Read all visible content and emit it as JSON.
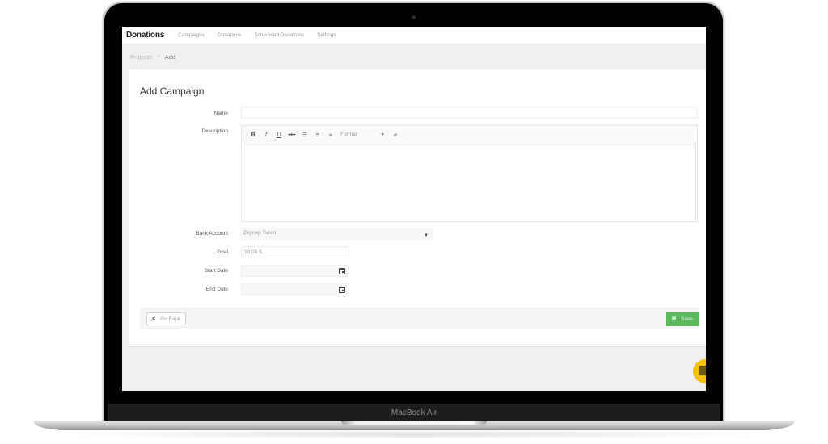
{
  "device": {
    "label": "MacBook Air"
  },
  "app": {
    "brand": "Donations",
    "nav": [
      {
        "label": "Campaigns"
      },
      {
        "label": "Donations"
      },
      {
        "label": "Scheduled Donations"
      },
      {
        "label": "Settings"
      }
    ]
  },
  "breadcrumb": {
    "parent": "Projects",
    "separator": ">",
    "current": "Add"
  },
  "form": {
    "title": "Add Campaign",
    "name": {
      "label": "Name",
      "value": ""
    },
    "description": {
      "label": "Description",
      "toolbar": {
        "bold": "B",
        "italic": "I",
        "underline": "U",
        "strikethrough": "abc",
        "bullet_list": "☰",
        "numbered_list": "≡",
        "link": "∞",
        "format": "Format",
        "format_caret": "▼",
        "clear": "⌀"
      },
      "value": ""
    },
    "bank_account": {
      "label": "Bank Account",
      "value": "Zeynep Turan"
    },
    "goal": {
      "label": "Goal",
      "value": "10.00 $"
    },
    "start_date": {
      "label": "Start Date",
      "value": ""
    },
    "end_date": {
      "label": "End Date",
      "value": ""
    }
  },
  "actions": {
    "back": {
      "icon": "chevron-left-icon",
      "glyph": "<",
      "label": "Go Back"
    },
    "save": {
      "icon": "floppy-disk-icon",
      "glyph": "H",
      "label": "Save"
    }
  },
  "colors": {
    "save_button": "#5cb85c",
    "help_fab": "#f2c200"
  }
}
